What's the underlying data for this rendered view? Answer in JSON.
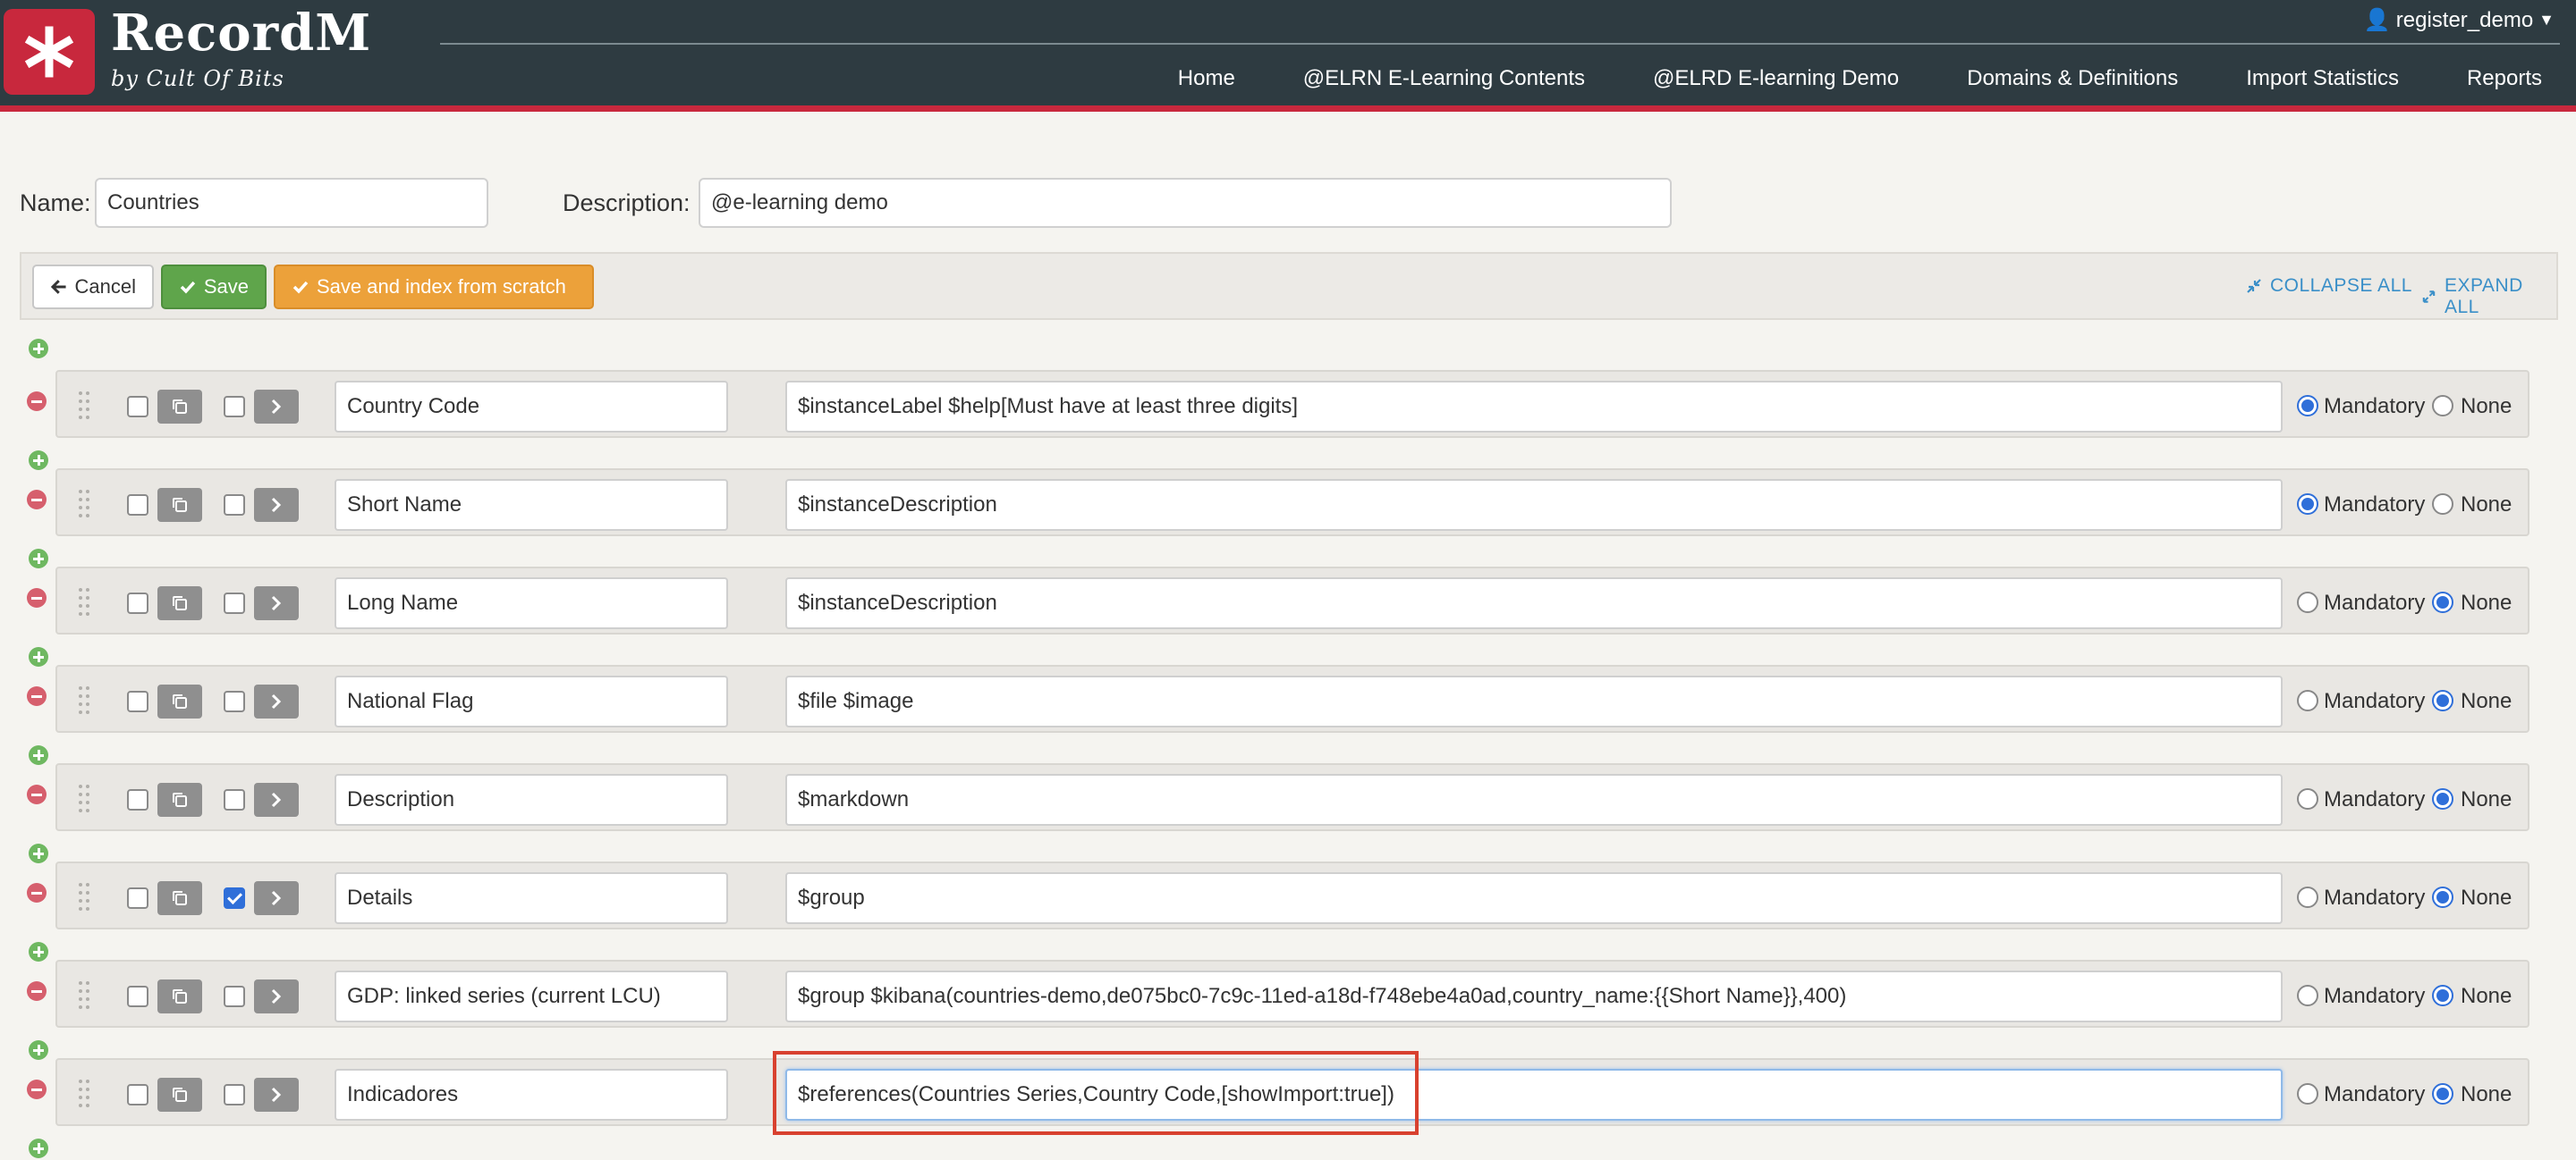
{
  "header": {
    "brand_name": "RecordM",
    "brand_sub": "by Cult Of Bits",
    "user": "register_demo",
    "nav": [
      "Home",
      "@ELRN E-Learning Contents",
      "@ELRD E-learning Demo",
      "Domains & Definitions",
      "Import Statistics",
      "Reports"
    ]
  },
  "form": {
    "name_label": "Name:",
    "name_value": "Countries",
    "description_label": "Description:",
    "description_value": "@e-learning demo"
  },
  "toolbar": {
    "cancel_label": "Cancel",
    "save_label": "Save",
    "save_index_label": "Save and index from scratch",
    "collapse_all_label": "COLLAPSE ALL",
    "expand_all_label": "EXPAND ALL"
  },
  "radio_labels": {
    "mandatory": "Mandatory",
    "none": "None"
  },
  "fields": [
    {
      "name": "Country Code",
      "description": "$instanceLabel $help[Must have at least three digits]",
      "checked": false,
      "mandatory": true
    },
    {
      "name": "Short Name",
      "description": "$instanceDescription",
      "checked": false,
      "mandatory": true
    },
    {
      "name": "Long Name",
      "description": "$instanceDescription",
      "checked": false,
      "mandatory": false
    },
    {
      "name": "National Flag",
      "description": "$file $image",
      "checked": false,
      "mandatory": false
    },
    {
      "name": "Description",
      "description": "$markdown",
      "checked": false,
      "mandatory": false
    },
    {
      "name": "Details",
      "description": "$group",
      "checked": true,
      "mandatory": false
    },
    {
      "name": "GDP: linked series (current LCU)",
      "description": "$group $kibana(countries-demo,de075bc0-7c9c-11ed-a18d-f748ebe4a0ad,country_name:{{Short Name}},400)",
      "checked": false,
      "mandatory": false
    },
    {
      "name": "Indicadores",
      "description": "$references(Countries Series,Country Code,[showImport:true])",
      "checked": false,
      "mandatory": false,
      "focused": true
    }
  ],
  "colors": {
    "accent": "#c8283d",
    "header_bg": "#2e3b41",
    "link": "#3a8fc8",
    "highlight": "#d8412f"
  }
}
